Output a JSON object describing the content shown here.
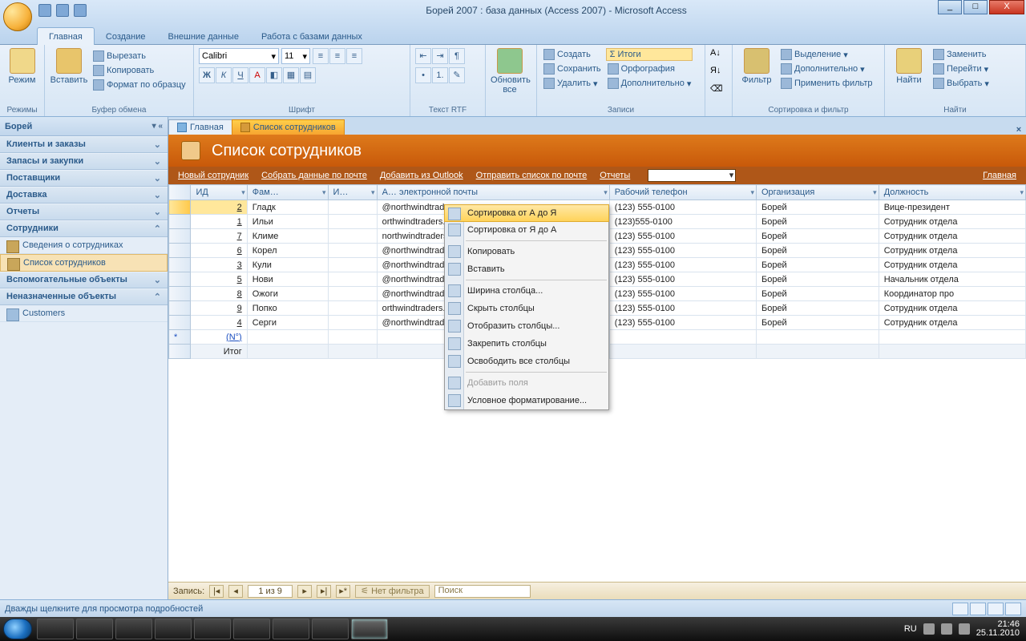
{
  "window": {
    "title": "Борей 2007 : база данных (Access 2007) - Microsoft Access",
    "min": "_",
    "max": "□",
    "close": "X"
  },
  "ribbon_tabs": [
    "Главная",
    "Создание",
    "Внешние данные",
    "Работа с базами данных"
  ],
  "ribbon": {
    "mode_btn": "Режим",
    "mode_group": "Режимы",
    "paste_btn": "Вставить",
    "cut": "Вырезать",
    "copy": "Копировать",
    "format_painter": "Формат по образцу",
    "clipboard_group": "Буфер обмена",
    "font_name": "Calibri",
    "font_size": "11",
    "font_group": "Шрифт",
    "rtf_group": "Текст RTF",
    "refresh": "Обновить все",
    "new": "Создать",
    "save": "Сохранить",
    "delete": "Удалить",
    "totals": "Σ Итоги",
    "spelling": "Орфография",
    "more": "Дополнительно",
    "records_group": "Записи",
    "filter": "Фильтр",
    "selection": "Выделение",
    "advanced": "Дополнительно",
    "toggle_filter": "Применить фильтр",
    "sort_group": "Сортировка и фильтр",
    "find": "Найти",
    "replace": "Заменить",
    "goto": "Перейти",
    "select": "Выбрать",
    "find_group": "Найти"
  },
  "nav": {
    "title": "Борей",
    "groups": [
      {
        "label": "Клиенты и заказы",
        "open": false
      },
      {
        "label": "Запасы и закупки",
        "open": false
      },
      {
        "label": "Поставщики",
        "open": false
      },
      {
        "label": "Доставка",
        "open": false
      },
      {
        "label": "Отчеты",
        "open": false
      },
      {
        "label": "Сотрудники",
        "open": true,
        "items": [
          {
            "label": "Сведения о сотрудниках",
            "type": "form",
            "selected": false
          },
          {
            "label": "Список сотрудников",
            "type": "form",
            "selected": true
          }
        ]
      },
      {
        "label": "Вспомогательные объекты",
        "open": false
      },
      {
        "label": "Неназначенные объекты",
        "open": true,
        "items": [
          {
            "label": "Customers",
            "type": "table",
            "selected": false
          }
        ]
      }
    ]
  },
  "doc_tabs": [
    {
      "label": "Главная",
      "kind": "home",
      "active": false
    },
    {
      "label": "Список сотрудников",
      "kind": "form",
      "active": true
    }
  ],
  "form": {
    "title": "Список сотрудников",
    "toolbar": {
      "new_emp": "Новый сотрудник",
      "collect": "Собрать данные по почте",
      "add_outlook": "Добавить из Outlook",
      "send_list": "Отправить список по почте",
      "reports": "Отчеты",
      "home": "Главная"
    }
  },
  "grid": {
    "columns": [
      "ИД",
      "Фам…",
      "И…",
      "А… электронной почты",
      "Рабочий телефон",
      "Организация",
      "Должность"
    ],
    "newrow_label": "(N°)",
    "totals_label": "Итог",
    "rows": [
      {
        "id": "2",
        "fam": "Гладк",
        "email": "@northwindtraders.com",
        "phone": "(123) 555-0100",
        "org": "Борей",
        "role": "Вице-президент"
      },
      {
        "id": "1",
        "fam": "Ильи",
        "email": "orthwindtraders.com",
        "phone": "(123)555-0100",
        "org": "Борей",
        "role": "Сотрудник отдела"
      },
      {
        "id": "7",
        "fam": "Климе",
        "email": "northwindtraders.com",
        "phone": "(123) 555-0100",
        "org": "Борей",
        "role": "Сотрудник отдела"
      },
      {
        "id": "6",
        "fam": "Корел",
        "email": "@northwindtraders.com",
        "phone": "(123) 555-0100",
        "org": "Борей",
        "role": "Сотрудник отдела"
      },
      {
        "id": "3",
        "fam": "Кули",
        "email": "@northwindtraders.com",
        "phone": "(123) 555-0100",
        "org": "Борей",
        "role": "Сотрудник отдела"
      },
      {
        "id": "5",
        "fam": "Нови",
        "email": "@northwindtraders.com",
        "phone": "(123) 555-0100",
        "org": "Борей",
        "role": "Начальник отдела"
      },
      {
        "id": "8",
        "fam": "Ожоги",
        "email": "@northwindtraders.com",
        "phone": "(123) 555-0100",
        "org": "Борей",
        "role": "Координатор про"
      },
      {
        "id": "9",
        "fam": "Попко",
        "email": "orthwindtraders.com",
        "phone": "(123) 555-0100",
        "org": "Борей",
        "role": "Сотрудник отдела"
      },
      {
        "id": "4",
        "fam": "Серги",
        "email": "@northwindtraders.com",
        "phone": "(123) 555-0100",
        "org": "Борей",
        "role": "Сотрудник отдела"
      }
    ]
  },
  "context_menu": [
    {
      "label": "Сортировка от А до Я",
      "hi": true
    },
    {
      "label": "Сортировка от Я до А"
    },
    {
      "sep": true
    },
    {
      "label": "Копировать"
    },
    {
      "label": "Вставить"
    },
    {
      "sep": true
    },
    {
      "label": "Ширина столбца..."
    },
    {
      "label": "Скрыть столбцы"
    },
    {
      "label": "Отобразить столбцы..."
    },
    {
      "label": "Закрепить столбцы"
    },
    {
      "label": "Освободить все столбцы"
    },
    {
      "sep": true
    },
    {
      "label": "Добавить поля",
      "disabled": true
    },
    {
      "label": "Условное форматирование..."
    }
  ],
  "record_nav": {
    "label": "Запись:",
    "value": "1 из 9",
    "nofilter": "Нет фильтра",
    "search": "Поиск"
  },
  "status_text": "Дважды щелкните для просмотра подробностей",
  "taskbar": {
    "lang": "RU",
    "time": "21:46",
    "date": "25.11.2010"
  }
}
